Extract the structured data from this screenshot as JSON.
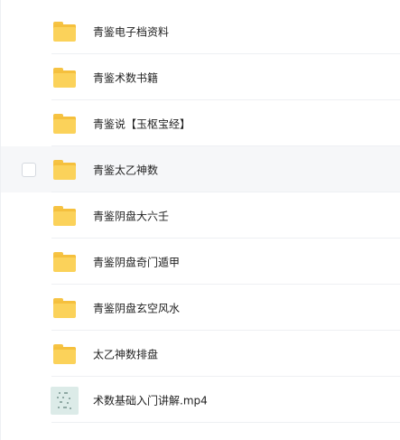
{
  "files": [
    {
      "name": "青鉴电子档资料",
      "type": "folder"
    },
    {
      "name": "青鉴术数书籍",
      "type": "folder"
    },
    {
      "name": "青鉴说【玉枢宝经】",
      "type": "folder"
    },
    {
      "name": "青鉴太乙神数",
      "type": "folder",
      "hovered": true
    },
    {
      "name": "青鉴阴盘大六壬",
      "type": "folder"
    },
    {
      "name": "青鉴阴盘奇门遁甲",
      "type": "folder"
    },
    {
      "name": "青鉴阴盘玄空风水",
      "type": "folder"
    },
    {
      "name": "太乙神数排盘",
      "type": "folder"
    },
    {
      "name": "术数基础入门讲解.mp4",
      "type": "video"
    }
  ],
  "icons": {
    "folder": "folder-icon",
    "video": "video-thumbnail"
  },
  "colors": {
    "folder": "#fbd25a",
    "hover_row": "#f6f7f9"
  }
}
